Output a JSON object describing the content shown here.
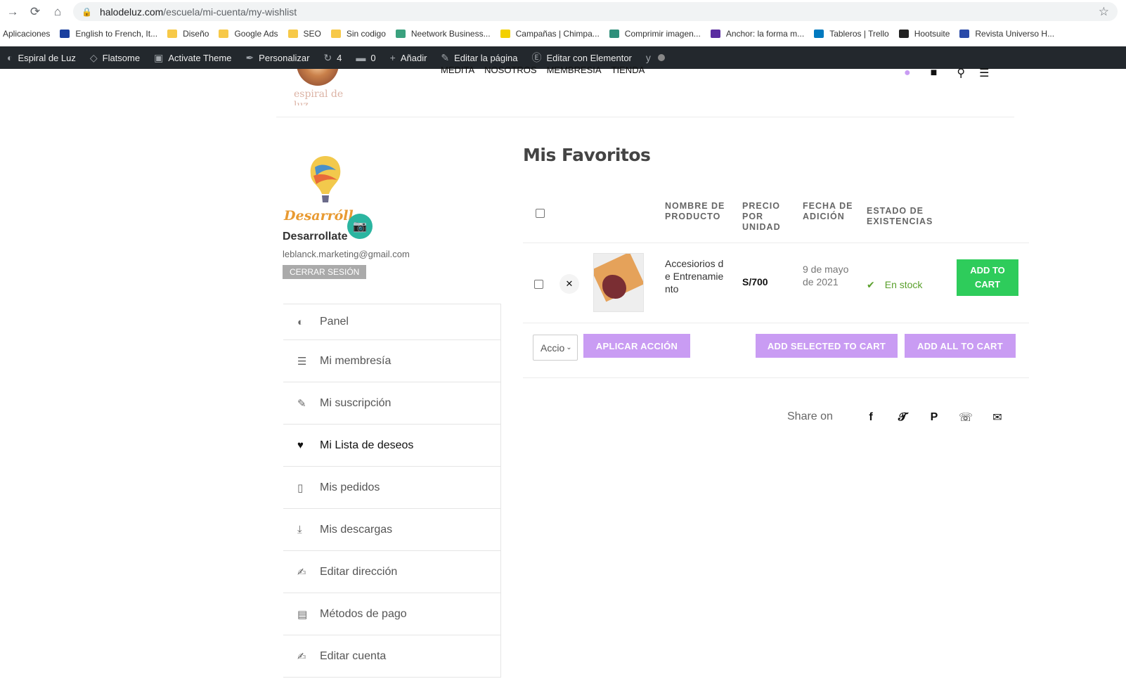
{
  "browser": {
    "url_domain": "halodeluz.com",
    "url_path": "/escuela/mi-cuenta/my-wishlist",
    "bookmarks": [
      {
        "label": "Aplicaciones",
        "icon": "apps-grid-icon",
        "color": ""
      },
      {
        "label": "English to French, It...",
        "icon": "wordreference-icon",
        "color": "#1a3f9e"
      },
      {
        "label": "Diseño",
        "icon": "folder-icon",
        "color": "#f7c948"
      },
      {
        "label": "Google Ads",
        "icon": "folder-icon",
        "color": "#f7c948"
      },
      {
        "label": "SEO",
        "icon": "folder-icon",
        "color": "#f7c948"
      },
      {
        "label": "Sin codigo",
        "icon": "folder-icon",
        "color": "#f7c948"
      },
      {
        "label": "Neetwork Business...",
        "icon": "neetwork-icon",
        "color": "#3aa17e"
      },
      {
        "label": "Campañas | Chimpa...",
        "icon": "mailchimp-icon",
        "color": "#f3d000"
      },
      {
        "label": "Comprimir imagen...",
        "icon": "compress-icon",
        "color": "#2f8f7a"
      },
      {
        "label": "Anchor: la forma m...",
        "icon": "anchor-icon",
        "color": "#5a2ca0"
      },
      {
        "label": "Tableros | Trello",
        "icon": "trello-icon",
        "color": "#0079bf"
      },
      {
        "label": "Hootsuite",
        "icon": "hootsuite-icon",
        "color": "#222"
      },
      {
        "label": "Revista Universo H...",
        "icon": "magazine-icon",
        "color": "#2a4aa8"
      }
    ]
  },
  "wp_admin_bar": {
    "items": [
      {
        "label": "Espiral de Luz",
        "icon": "dashboard-icon"
      },
      {
        "label": "Flatsome",
        "icon": "flatsome-icon"
      },
      {
        "label": "Activate Theme",
        "icon": "lock-icon"
      },
      {
        "label": "Personalizar",
        "icon": "brush-icon"
      },
      {
        "label": "4",
        "icon": "refresh-icon"
      },
      {
        "label": "0",
        "icon": "comment-icon"
      },
      {
        "label": "Añadir",
        "icon": "plus-icon"
      },
      {
        "label": "Editar la página",
        "icon": "pencil-icon"
      },
      {
        "label": "Editar con Elementor",
        "icon": "elementor-icon"
      }
    ]
  },
  "header": {
    "logo_text": "espiral de luz",
    "nav": [
      "MEDITA",
      "NOSOTROS",
      "MEMBRESIA",
      "TIENDA"
    ]
  },
  "profile": {
    "avatar_text": "Desarróll",
    "name": "Desarrollate",
    "email": "leblanck.marketing@gmail.com",
    "logout_label": "CERRAR SESIÓN"
  },
  "account_nav": [
    {
      "label": "Panel",
      "icon": "dashboard-icon",
      "active": false
    },
    {
      "label": "Mi membresía",
      "icon": "list-icon",
      "active": false
    },
    {
      "label": "Mi suscripción",
      "icon": "pencil-icon",
      "active": false
    },
    {
      "label": "Mi Lista de deseos",
      "icon": "heart-icon",
      "active": true
    },
    {
      "label": "Mis pedidos",
      "icon": "document-icon",
      "active": false
    },
    {
      "label": "Mis descargas",
      "icon": "download-icon",
      "active": false
    },
    {
      "label": "Editar dirección",
      "icon": "edit-icon",
      "active": false
    },
    {
      "label": "Métodos de pago",
      "icon": "money-icon",
      "active": false
    },
    {
      "label": "Editar cuenta",
      "icon": "edit-icon",
      "active": false
    }
  ],
  "wishlist": {
    "title": "Mis Favoritos",
    "columns": {
      "name": "NOMBRE DE PRODUCTO",
      "price": "PRECIO POR UNIDAD",
      "date": "FECHA DE ADICIÓN",
      "stock": "ESTADO DE EXISTENCIAS"
    },
    "items": [
      {
        "name": "Accesiorios de Entrenamiento",
        "price": "S/700",
        "date": "9 de mayo de 2021",
        "stock": "En stock",
        "add_to_cart_label": "ADD TO CART"
      }
    ],
    "action_select_value": "Accio",
    "apply_action_label": "APLICAR ACCIÓN",
    "add_selected_label": "ADD SELECTED TO CART",
    "add_all_label": "ADD ALL TO CART",
    "share_label": "Share on",
    "share_icons": [
      "facebook-icon",
      "twitter-icon",
      "pinterest-icon",
      "whatsapp-icon",
      "email-icon"
    ]
  },
  "colors": {
    "admin_bar": "#23282d",
    "primary_purple": "#c99cf3",
    "add_to_cart_green": "#2ecc5b",
    "stock_green": "#5aa02c",
    "camera_teal": "#2bb5a0"
  }
}
